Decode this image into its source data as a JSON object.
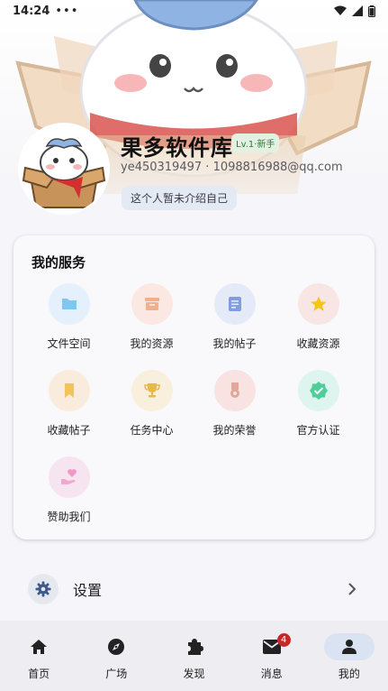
{
  "status_bar": {
    "time": "14:24",
    "dots": "•••"
  },
  "profile": {
    "nickname": "果多软件库",
    "level": "Lv.1·新手",
    "account_id": "ye450319497",
    "email": "1098816988@qq.com",
    "account_separator": "·",
    "bio": "这个人暂未介绍自己"
  },
  "services": {
    "title": "我的服务",
    "items": [
      {
        "label": "文件空间",
        "icon": "folder-icon",
        "bg": "#e4f0fb",
        "color": "#7ec8f0"
      },
      {
        "label": "我的资源",
        "icon": "archive-box-icon",
        "bg": "#fbe8e2",
        "color": "#f0b08c"
      },
      {
        "label": "我的帖子",
        "icon": "document-icon",
        "bg": "#e4eaf7",
        "color": "#7f9de0"
      },
      {
        "label": "收藏资源",
        "icon": "star-icon",
        "bg": "#f8e6e4",
        "color": "#f5c518"
      },
      {
        "label": "收藏帖子",
        "icon": "bookmark-icon",
        "bg": "#f9ecdc",
        "color": "#f3c35b"
      },
      {
        "label": "任务中心",
        "icon": "trophy-icon",
        "bg": "#f9efdd",
        "color": "#e8b94a"
      },
      {
        "label": "我的荣誉",
        "icon": "medal-icon",
        "bg": "#f8e2e2",
        "color": "#dfa89a"
      },
      {
        "label": "官方认证",
        "icon": "verified-badge-icon",
        "bg": "#def5ef",
        "color": "#4ccf99"
      },
      {
        "label": "赞助我们",
        "icon": "heart-hand-icon",
        "bg": "#f6e4f1",
        "color": "#ef9ac5"
      }
    ]
  },
  "settings": {
    "label": "设置",
    "icon": "gear-icon"
  },
  "nav": {
    "items": [
      {
        "label": "首页",
        "icon": "home-icon"
      },
      {
        "label": "广场",
        "icon": "compass-icon"
      },
      {
        "label": "发现",
        "icon": "puzzle-icon"
      },
      {
        "label": "消息",
        "icon": "mail-icon",
        "badge": "4"
      },
      {
        "label": "我的",
        "icon": "person-icon"
      }
    ],
    "active_index": 4
  },
  "colors": {
    "accent": "#d9e3f2",
    "badge": "#c62828"
  }
}
